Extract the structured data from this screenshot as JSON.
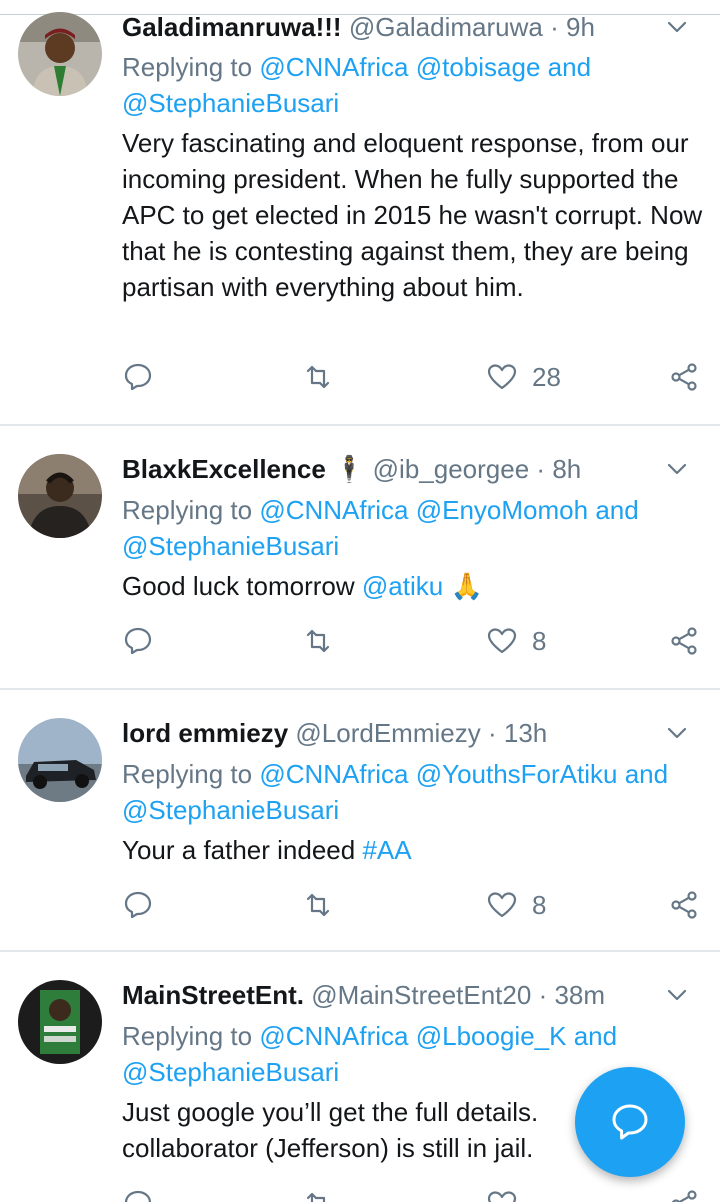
{
  "tweets": [
    {
      "name": "Galadimanruwa!!!",
      "handle": "@Galadimaruwa",
      "dot": "·",
      "time": "9h",
      "reply_prefix": "Replying to",
      "reply_mentions": "@CNNAfrica @tobisage",
      "reply_and": "and",
      "reply_last": "@StephanieBusari",
      "text": "Very fascinating and eloquent response, from our incoming president. When he fully supported the APC to get elected in 2015 he wasn't corrupt. Now that he is contesting against them, they are being partisan with everything about him.",
      "likes": "28"
    },
    {
      "name": "BlaxkExcellence",
      "name_emoji": "🕴",
      "handle": "@ib_georgee",
      "dot": "·",
      "time": "8h",
      "reply_prefix": "Replying to",
      "reply_mentions": "@CNNAfrica @EnyoMomoh",
      "reply_and": "and",
      "reply_last": "@StephanieBusari",
      "text": "Good luck tomorrow",
      "text_mention": "@atiku",
      "text_emoji": "🙏",
      "likes": "8"
    },
    {
      "name": "lord emmiezy",
      "handle": "@LordEmmiezy",
      "dot": "·",
      "time": "13h",
      "reply_prefix": "Replying to",
      "reply_mentions": "@CNNAfrica @YouthsForAtiku",
      "reply_and": "and",
      "reply_last": "@StephanieBusari",
      "text": "Your a father indeed",
      "text_hashtag": "#AA",
      "likes": "8"
    },
    {
      "name": "MainStreetEnt.",
      "handle": "@MainStreetEnt20",
      "dot": "·",
      "time": "38m",
      "reply_prefix": "Replying to",
      "reply_mentions": "@CNNAfrica @Lboogie_K",
      "reply_and": "and",
      "reply_last": "@StephanieBusari",
      "text_line1": "Just google you’ll get the full details.",
      "text_line2": "collaborator (Jefferson) is still in jail."
    }
  ],
  "icons": {
    "reply": "reply-icon",
    "retweet": "retweet-icon",
    "like": "heart-icon",
    "share": "share-icon",
    "more": "chevron-down-icon",
    "compose": "compose-reply-icon"
  },
  "colors": {
    "link": "#1da1f2",
    "muted": "#657786",
    "text": "#14171a",
    "divider": "#e1e8ed",
    "fab": "#1da1f2"
  }
}
